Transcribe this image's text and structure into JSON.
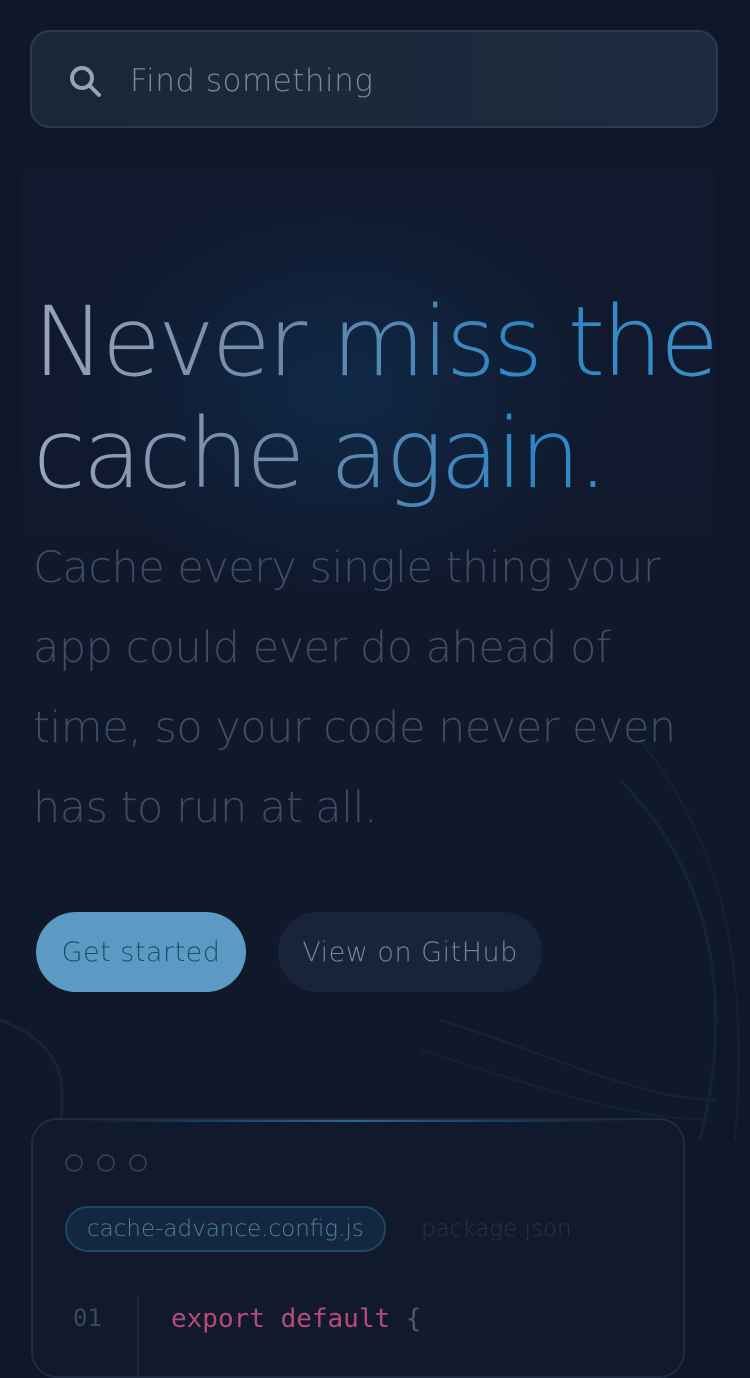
{
  "search": {
    "placeholder": "Find something"
  },
  "hero": {
    "title": "Never miss the cache again.",
    "subtitle": "Cache every single thing your app could ever do ahead of time, so your code never even has to run at all."
  },
  "actions": {
    "primary_label": "Get started",
    "secondary_label": "View on GitHub"
  },
  "code_window": {
    "tabs": [
      {
        "label": "cache-advance.config.js",
        "active": true
      },
      {
        "label": "package.json",
        "active": false
      }
    ],
    "lines": [
      {
        "number": "01",
        "keyword": "export default",
        "punct": "{"
      }
    ]
  },
  "colors": {
    "background": "#0f172a",
    "accent": "#5b9ac3",
    "keyword": "#b84a7a"
  },
  "icons": {
    "search": "search-icon"
  }
}
